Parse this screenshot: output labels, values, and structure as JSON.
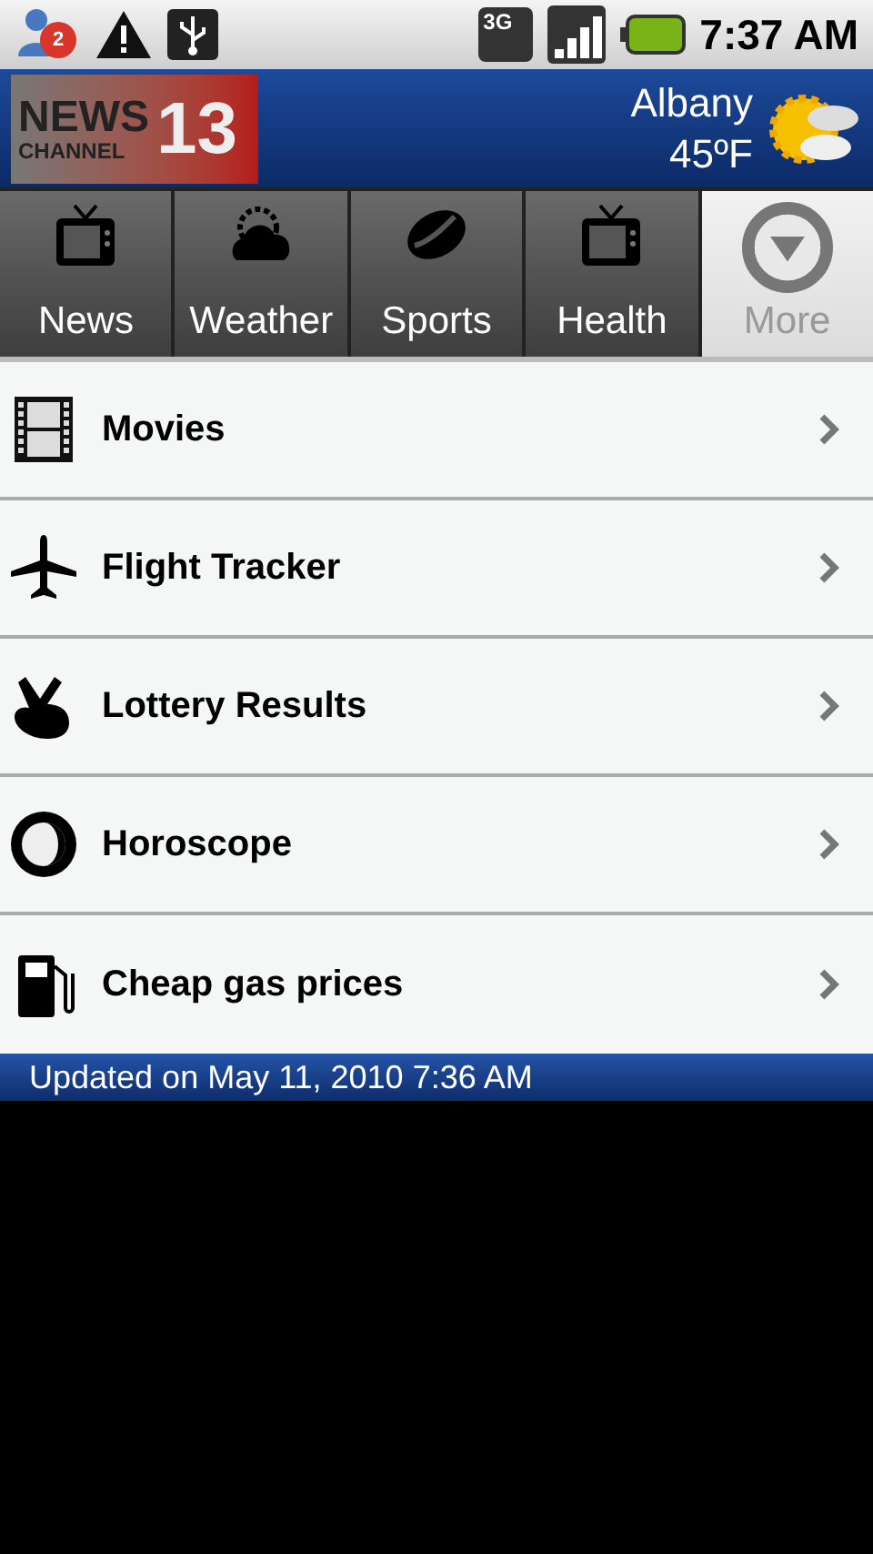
{
  "status_bar": {
    "notification_count": "2",
    "network": "3G",
    "time": "7:37 AM"
  },
  "header": {
    "logo": {
      "line_1": "NEWS",
      "line_2": "CHANNEL",
      "number": "13"
    },
    "city": "Albany",
    "temperature": "45ºF"
  },
  "tabs": [
    {
      "label": "News",
      "selected": false
    },
    {
      "label": "Weather",
      "selected": false
    },
    {
      "label": "Sports",
      "selected": false
    },
    {
      "label": "Health",
      "selected": false
    },
    {
      "label": "More",
      "selected": true
    }
  ],
  "menu_items": [
    {
      "label": "Movies"
    },
    {
      "label": "Flight Tracker"
    },
    {
      "label": "Lottery Results"
    },
    {
      "label": "Horoscope"
    },
    {
      "label": "Cheap gas prices"
    }
  ],
  "footer": "Updated on May 11, 2010 7:36 AM"
}
